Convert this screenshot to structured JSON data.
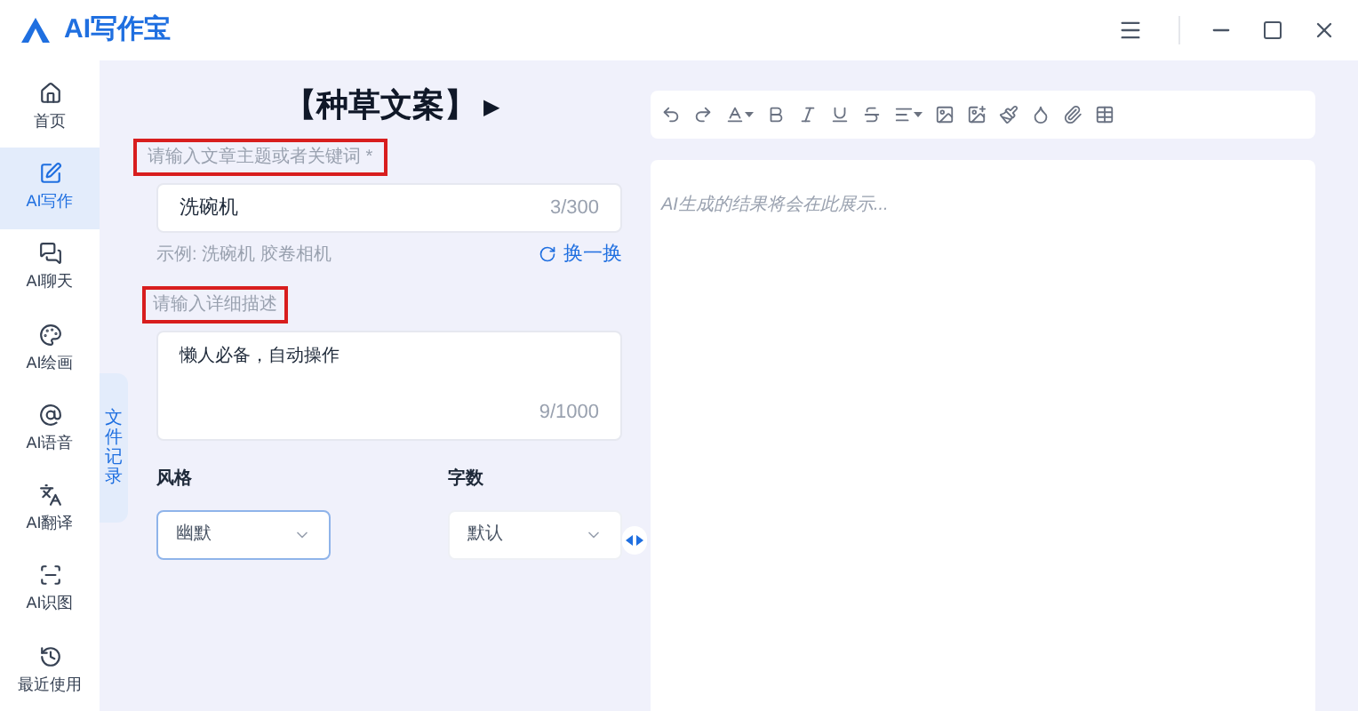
{
  "app": {
    "title": "AI写作宝"
  },
  "sidebar": {
    "items": [
      {
        "label": "首页",
        "selected": false
      },
      {
        "label": "AI写作",
        "selected": true
      },
      {
        "label": "AI聊天",
        "selected": false
      },
      {
        "label": "AI绘画",
        "selected": false
      },
      {
        "label": "AI语音",
        "selected": false
      },
      {
        "label": "AI翻译",
        "selected": false
      },
      {
        "label": "AI识图",
        "selected": false
      },
      {
        "label": "最近使用",
        "selected": false
      }
    ]
  },
  "side_tab": {
    "label": "文件记录"
  },
  "form": {
    "title": "【种草文案】",
    "title_arrow": "▶",
    "topic": {
      "label": "请输入文章主题或者关键词 *",
      "value": "洗碗机",
      "counter": "3/300"
    },
    "example": "示例: 洗碗机 胶卷相机",
    "shuffle": "换一换",
    "detail": {
      "label": "请输入详细描述",
      "value": "懒人必备，自动操作",
      "counter": "9/1000"
    },
    "selects": [
      {
        "label": "风格",
        "value": "幽默",
        "focused": true
      },
      {
        "label": "字数",
        "value": "默认",
        "focused": false
      }
    ]
  },
  "editor": {
    "placeholder": "AI生成的结果将会在此展示..."
  }
}
